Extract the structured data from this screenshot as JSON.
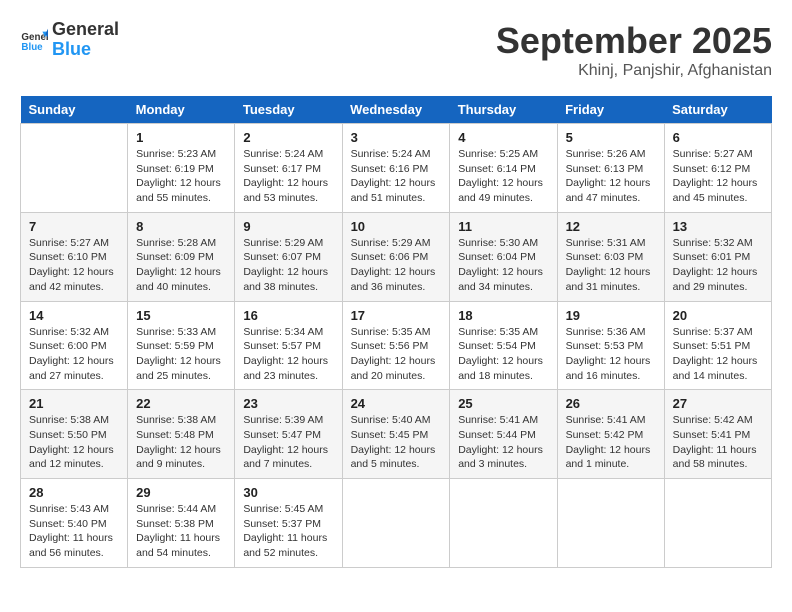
{
  "header": {
    "logo_line1": "General",
    "logo_line2": "Blue",
    "title": "September 2025",
    "subtitle": "Khinj, Panjshir, Afghanistan"
  },
  "weekdays": [
    "Sunday",
    "Monday",
    "Tuesday",
    "Wednesday",
    "Thursday",
    "Friday",
    "Saturday"
  ],
  "weeks": [
    [
      {
        "day": "",
        "detail": ""
      },
      {
        "day": "1",
        "detail": "Sunrise: 5:23 AM\nSunset: 6:19 PM\nDaylight: 12 hours\nand 55 minutes."
      },
      {
        "day": "2",
        "detail": "Sunrise: 5:24 AM\nSunset: 6:17 PM\nDaylight: 12 hours\nand 53 minutes."
      },
      {
        "day": "3",
        "detail": "Sunrise: 5:24 AM\nSunset: 6:16 PM\nDaylight: 12 hours\nand 51 minutes."
      },
      {
        "day": "4",
        "detail": "Sunrise: 5:25 AM\nSunset: 6:14 PM\nDaylight: 12 hours\nand 49 minutes."
      },
      {
        "day": "5",
        "detail": "Sunrise: 5:26 AM\nSunset: 6:13 PM\nDaylight: 12 hours\nand 47 minutes."
      },
      {
        "day": "6",
        "detail": "Sunrise: 5:27 AM\nSunset: 6:12 PM\nDaylight: 12 hours\nand 45 minutes."
      }
    ],
    [
      {
        "day": "7",
        "detail": "Sunrise: 5:27 AM\nSunset: 6:10 PM\nDaylight: 12 hours\nand 42 minutes."
      },
      {
        "day": "8",
        "detail": "Sunrise: 5:28 AM\nSunset: 6:09 PM\nDaylight: 12 hours\nand 40 minutes."
      },
      {
        "day": "9",
        "detail": "Sunrise: 5:29 AM\nSunset: 6:07 PM\nDaylight: 12 hours\nand 38 minutes."
      },
      {
        "day": "10",
        "detail": "Sunrise: 5:29 AM\nSunset: 6:06 PM\nDaylight: 12 hours\nand 36 minutes."
      },
      {
        "day": "11",
        "detail": "Sunrise: 5:30 AM\nSunset: 6:04 PM\nDaylight: 12 hours\nand 34 minutes."
      },
      {
        "day": "12",
        "detail": "Sunrise: 5:31 AM\nSunset: 6:03 PM\nDaylight: 12 hours\nand 31 minutes."
      },
      {
        "day": "13",
        "detail": "Sunrise: 5:32 AM\nSunset: 6:01 PM\nDaylight: 12 hours\nand 29 minutes."
      }
    ],
    [
      {
        "day": "14",
        "detail": "Sunrise: 5:32 AM\nSunset: 6:00 PM\nDaylight: 12 hours\nand 27 minutes."
      },
      {
        "day": "15",
        "detail": "Sunrise: 5:33 AM\nSunset: 5:59 PM\nDaylight: 12 hours\nand 25 minutes."
      },
      {
        "day": "16",
        "detail": "Sunrise: 5:34 AM\nSunset: 5:57 PM\nDaylight: 12 hours\nand 23 minutes."
      },
      {
        "day": "17",
        "detail": "Sunrise: 5:35 AM\nSunset: 5:56 PM\nDaylight: 12 hours\nand 20 minutes."
      },
      {
        "day": "18",
        "detail": "Sunrise: 5:35 AM\nSunset: 5:54 PM\nDaylight: 12 hours\nand 18 minutes."
      },
      {
        "day": "19",
        "detail": "Sunrise: 5:36 AM\nSunset: 5:53 PM\nDaylight: 12 hours\nand 16 minutes."
      },
      {
        "day": "20",
        "detail": "Sunrise: 5:37 AM\nSunset: 5:51 PM\nDaylight: 12 hours\nand 14 minutes."
      }
    ],
    [
      {
        "day": "21",
        "detail": "Sunrise: 5:38 AM\nSunset: 5:50 PM\nDaylight: 12 hours\nand 12 minutes."
      },
      {
        "day": "22",
        "detail": "Sunrise: 5:38 AM\nSunset: 5:48 PM\nDaylight: 12 hours\nand 9 minutes."
      },
      {
        "day": "23",
        "detail": "Sunrise: 5:39 AM\nSunset: 5:47 PM\nDaylight: 12 hours\nand 7 minutes."
      },
      {
        "day": "24",
        "detail": "Sunrise: 5:40 AM\nSunset: 5:45 PM\nDaylight: 12 hours\nand 5 minutes."
      },
      {
        "day": "25",
        "detail": "Sunrise: 5:41 AM\nSunset: 5:44 PM\nDaylight: 12 hours\nand 3 minutes."
      },
      {
        "day": "26",
        "detail": "Sunrise: 5:41 AM\nSunset: 5:42 PM\nDaylight: 12 hours\nand 1 minute."
      },
      {
        "day": "27",
        "detail": "Sunrise: 5:42 AM\nSunset: 5:41 PM\nDaylight: 11 hours\nand 58 minutes."
      }
    ],
    [
      {
        "day": "28",
        "detail": "Sunrise: 5:43 AM\nSunset: 5:40 PM\nDaylight: 11 hours\nand 56 minutes."
      },
      {
        "day": "29",
        "detail": "Sunrise: 5:44 AM\nSunset: 5:38 PM\nDaylight: 11 hours\nand 54 minutes."
      },
      {
        "day": "30",
        "detail": "Sunrise: 5:45 AM\nSunset: 5:37 PM\nDaylight: 11 hours\nand 52 minutes."
      },
      {
        "day": "",
        "detail": ""
      },
      {
        "day": "",
        "detail": ""
      },
      {
        "day": "",
        "detail": ""
      },
      {
        "day": "",
        "detail": ""
      }
    ]
  ]
}
